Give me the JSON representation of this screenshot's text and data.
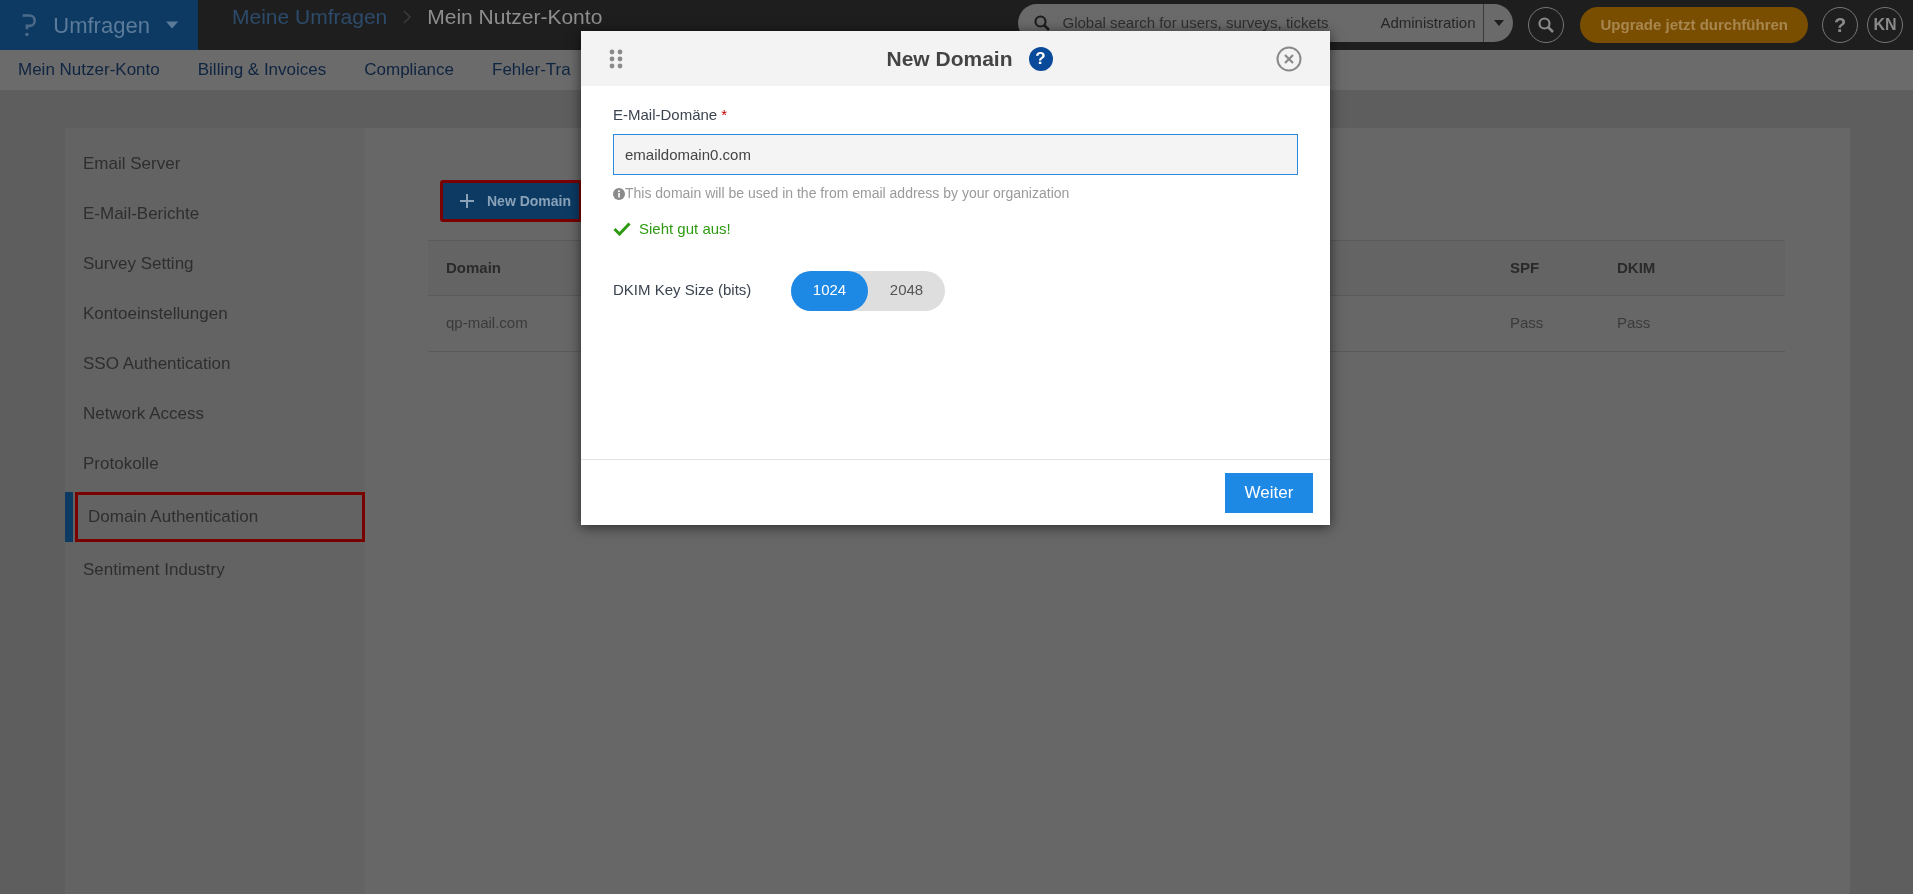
{
  "topbar": {
    "app_menu": {
      "label": "Umfragen"
    },
    "breadcrumb": [
      "Meine Umfragen",
      "Mein Nutzer-Konto"
    ],
    "search": {
      "placeholder": "Global search for users, surveys, tickets",
      "scope": "Administration"
    },
    "upgrade_button": "Upgrade jetzt durchführen",
    "help": "?",
    "avatar": "KN"
  },
  "nav": {
    "items": [
      "Mein Nutzer-Konto",
      "Billing & Invoices",
      "Compliance",
      "Fehler-Tra"
    ]
  },
  "sidebar": {
    "items": [
      {
        "label": "Email Server",
        "selected": false,
        "highlighted": false
      },
      {
        "label": "E-Mail-Berichte",
        "selected": false,
        "highlighted": false
      },
      {
        "label": "Survey Setting",
        "selected": false,
        "highlighted": false
      },
      {
        "label": "Kontoeinstellungen",
        "selected": false,
        "highlighted": false
      },
      {
        "label": "SSO Authentication",
        "selected": false,
        "highlighted": false
      },
      {
        "label": "Network Access",
        "selected": false,
        "highlighted": false
      },
      {
        "label": "Protokolle",
        "selected": false,
        "highlighted": false
      },
      {
        "label": "Domain Authentication",
        "selected": true,
        "highlighted": true
      },
      {
        "label": "Sentiment Industry",
        "selected": false,
        "highlighted": false
      }
    ]
  },
  "content": {
    "new_domain_button": {
      "label": "New Domain",
      "highlighted": true
    },
    "table": {
      "columns": [
        "Domain",
        "SPF",
        "DKIM"
      ],
      "rows": [
        [
          "qp-mail.com",
          "Pass",
          "Pass"
        ]
      ]
    }
  },
  "modal": {
    "title": "New Domain",
    "help": "?",
    "field": {
      "label": "E-Mail-Domäne",
      "required_mark": "*",
      "value": "emaildomain0.com",
      "hint": "This domain will be used in the from email address by your organization",
      "validation": "Sieht gut aus!"
    },
    "key_size": {
      "label": "DKIM Key Size (bits)",
      "options": [
        {
          "label": "1024",
          "selected": true
        },
        {
          "label": "2048",
          "selected": false
        }
      ]
    },
    "submit": "Weiter"
  }
}
